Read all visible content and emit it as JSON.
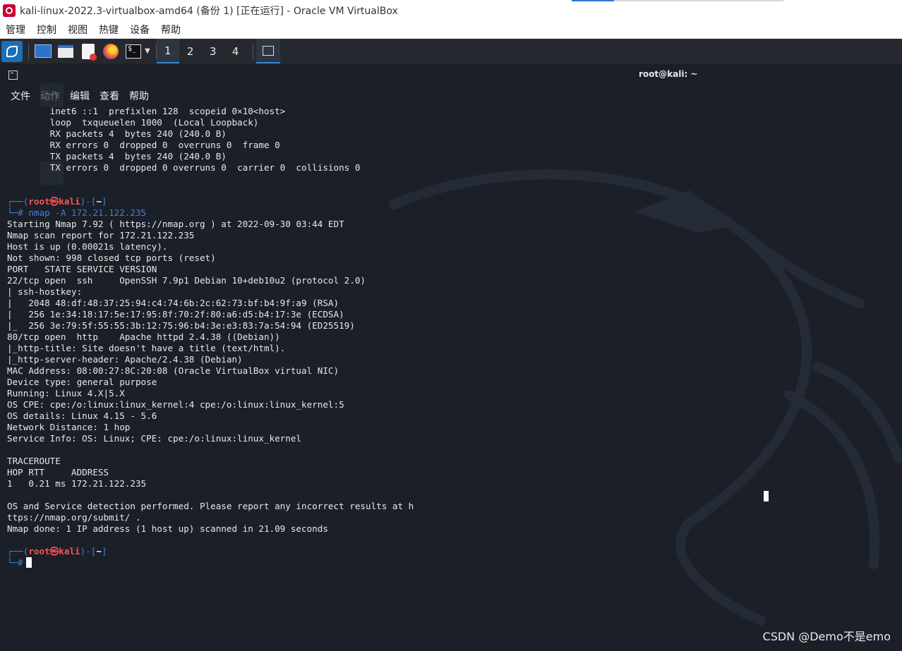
{
  "window": {
    "title": "kali-linux-2022.3-virtualbox-amd64 (备份 1) [正在运行] - Oracle VM VirtualBox"
  },
  "vbox_menu": [
    "管理",
    "控制",
    "视图",
    "热键",
    "设备",
    "帮助"
  ],
  "panel": {
    "workspaces": [
      "1",
      "2",
      "3",
      "4"
    ],
    "icons": [
      "kali-menu-icon",
      "desktop-icon",
      "file-manager-icon",
      "text-editor-icon",
      "firefox-icon",
      "terminal-icon"
    ]
  },
  "terminal": {
    "title": "root@kali: ~",
    "menu": [
      "文件",
      "动作",
      "编辑",
      "查看",
      "帮助"
    ],
    "top_lines": [
      "        inet6 ::1  prefixlen 128  scopeid 0×10<host>",
      "        loop  txqueuelen 1000  (Local Loopback)",
      "        RX packets 4  bytes 240 (240.0 B)",
      "        RX errors 0  dropped 0  overruns 0  frame 0",
      "        TX packets 4  bytes 240 (240.0 B)",
      "        TX errors 0  dropped 0 overruns 0  carrier 0  collisions 0"
    ],
    "prompt_open": "┌──(",
    "prompt_user": "root㉿kali",
    "prompt_mid": ")-[",
    "prompt_dir": "~",
    "prompt_close": "]",
    "prompt_hash": "└─#",
    "command": " nmap -A 172.21.122.235",
    "output": [
      "Starting Nmap 7.92 ( https://nmap.org ) at 2022-09-30 03:44 EDT",
      "Nmap scan report for 172.21.122.235",
      "Host is up (0.00021s latency).",
      "Not shown: 998 closed tcp ports (reset)",
      "PORT   STATE SERVICE VERSION",
      "22/tcp open  ssh     OpenSSH 7.9p1 Debian 10+deb10u2 (protocol 2.0)",
      "| ssh-hostkey: ",
      "|   2048 48:df:48:37:25:94:c4:74:6b:2c:62:73:bf:b4:9f:a9 (RSA)",
      "|   256 1e:34:18:17:5e:17:95:8f:70:2f:80:a6:d5:b4:17:3e (ECDSA)",
      "|_  256 3e:79:5f:55:55:3b:12:75:96:b4:3e:e3:83:7a:54:94 (ED25519)",
      "80/tcp open  http    Apache httpd 2.4.38 ((Debian))",
      "|_http-title: Site doesn't have a title (text/html).",
      "|_http-server-header: Apache/2.4.38 (Debian)",
      "MAC Address: 08:00:27:8C:20:08 (Oracle VirtualBox virtual NIC)",
      "Device type: general purpose",
      "Running: Linux 4.X|5.X",
      "OS CPE: cpe:/o:linux:linux_kernel:4 cpe:/o:linux:linux_kernel:5",
      "OS details: Linux 4.15 - 5.6",
      "Network Distance: 1 hop",
      "Service Info: OS: Linux; CPE: cpe:/o:linux:linux_kernel",
      "",
      "TRACEROUTE",
      "HOP RTT     ADDRESS",
      "1   0.21 ms 172.21.122.235",
      "",
      "OS and Service detection performed. Please report any incorrect results at h",
      "ttps://nmap.org/submit/ .",
      "Nmap done: 1 IP address (1 host up) scanned in 21.09 seconds"
    ]
  },
  "watermark": "CSDN @Demo不是emo",
  "colors": {
    "prompt_user": "#ff5555",
    "prompt_frame": "#3f7fdc",
    "terminal_bg": "#1b1f27",
    "panel_bg": "#25292f"
  }
}
